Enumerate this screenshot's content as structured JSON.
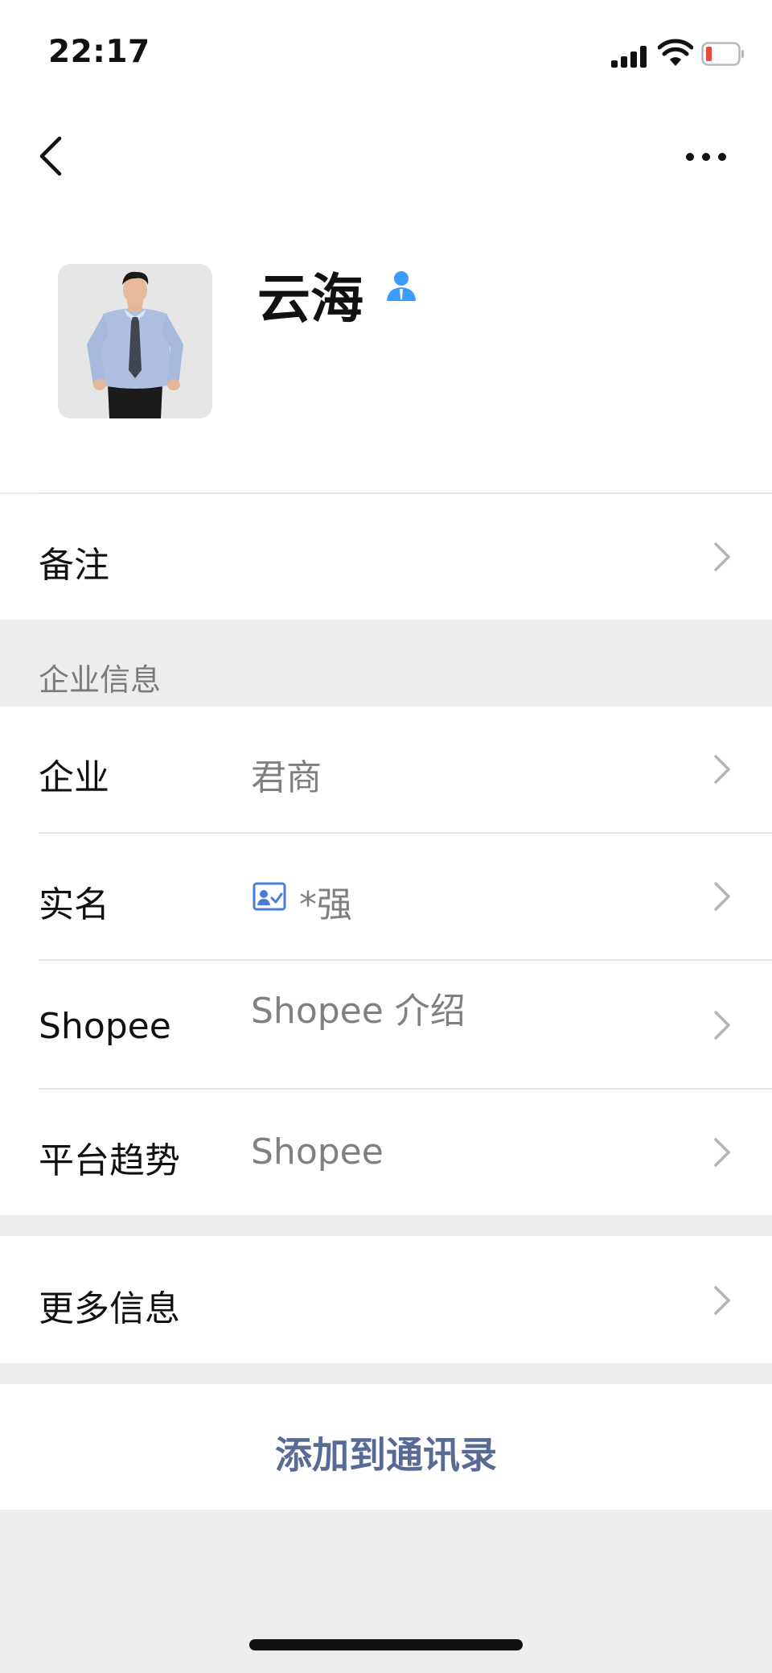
{
  "status_bar": {
    "time": "22:17"
  },
  "profile": {
    "name": "云海"
  },
  "remark": {
    "label": "备注"
  },
  "enterprise_section": {
    "title": "企业信息",
    "rows": [
      {
        "label": "企业",
        "value": "君商"
      },
      {
        "label": "实名",
        "value": "*强"
      },
      {
        "label": "Shopee",
        "value": "Shopee 介绍"
      },
      {
        "label": "平台趋势",
        "value": "Shopee"
      }
    ]
  },
  "more_info": {
    "label": "更多信息"
  },
  "action": {
    "add_to_contacts": "添加到通讯录"
  },
  "colors": {
    "accent": "#576b95",
    "verified_blue": "#3b9cff",
    "battery_low": "#e84a3c"
  }
}
